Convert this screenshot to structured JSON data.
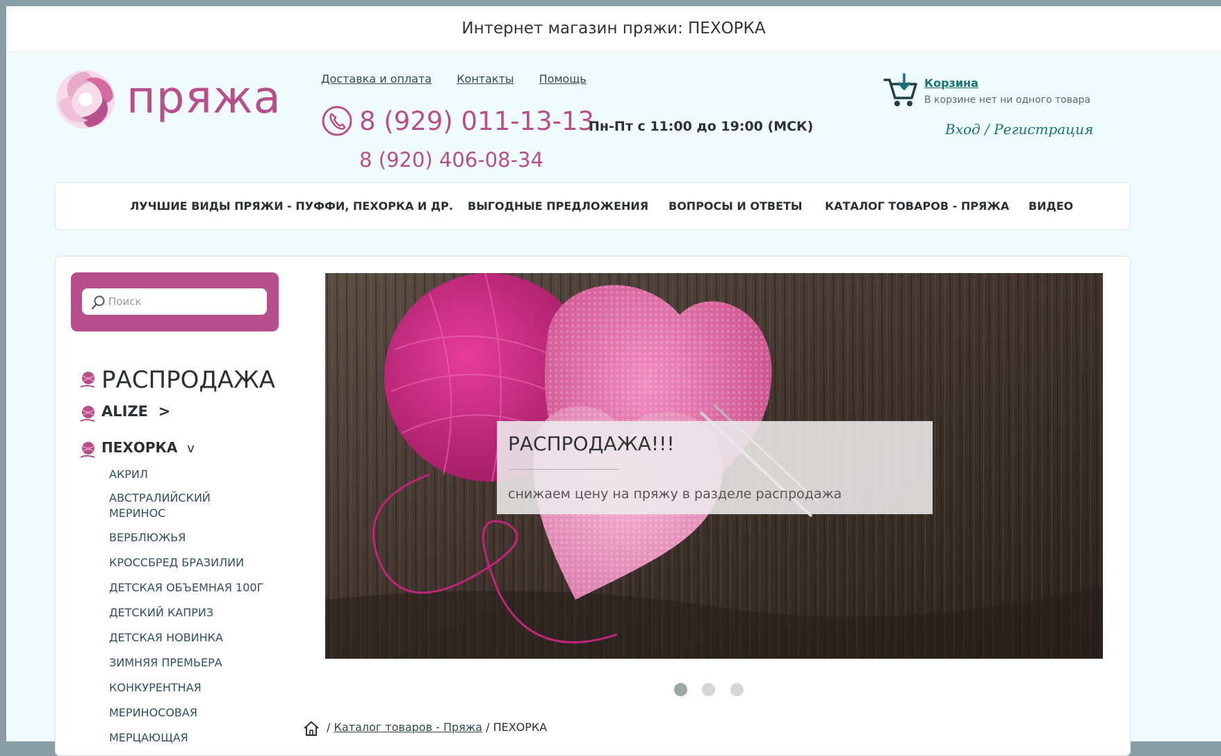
{
  "window": {
    "title": "Интернет магазин пряжи: ПЕХОРКА"
  },
  "header": {
    "logo_text": "пряжа",
    "links": [
      "Доставка и оплата",
      "Контакты",
      "Помощь"
    ],
    "phone_primary": "8 (929) 011-13-13",
    "phone_secondary": "8 (920) 406-08-34",
    "hours": "Пн-Пт с 11:00 до 19:00 (МСК)",
    "cart_title": "Корзина",
    "cart_status": "В корзине нет ни одного товара",
    "auth_links": "Вход / Регистрация"
  },
  "nav": {
    "items": [
      "ЛУЧШИЕ ВИДЫ ПРЯЖИ - ПУФФИ, ПЕХОРКА И ДР.",
      "ВЫГОДНЫЕ ПРЕДЛОЖЕНИЯ",
      "ВОПРОСЫ И ОТВЕТЫ",
      "КАТАЛОГ ТОВАРОВ - ПРЯЖА",
      "ВИДЕО"
    ]
  },
  "search": {
    "placeholder": "Поиск",
    "value": ""
  },
  "sidebar": {
    "sale": "РАСПРОДАЖА",
    "alize": {
      "label": "ALIZE",
      "arrow": ">"
    },
    "pekhorka": {
      "label": "ПЕХОРКА",
      "arrow": "v"
    },
    "subitems": [
      "АКРИЛ",
      "АВСТРАЛИЙСКИЙ МЕРИНОС",
      "ВЕРБЛЮЖЬЯ",
      "КРОССБРЕД БРАЗИЛИИ",
      "ДЕТСКАЯ ОБЪЕМНАЯ 100Г",
      "ДЕТСКИЙ КАПРИЗ",
      "ДЕТСКАЯ НОВИНКА",
      "ЗИМНЯЯ ПРЕМЬЕРА",
      "КОНКУРЕНТНАЯ",
      "МЕРИНОСОВАЯ",
      "МЕРЦАЮЩАЯ"
    ]
  },
  "banner": {
    "heading": "РАСПРОДАЖА!!!",
    "subtext": "снижаем цену на пряжу в разделе распродажа",
    "slide_count": 3,
    "active_slide": 1
  },
  "breadcrumb": {
    "separator": "/",
    "link": "Каталог товаров - Пряжа",
    "current": "ПЕХОРКА"
  },
  "colors": {
    "brand": "#b84f8d",
    "link": "#16737a",
    "page_bg": "#effbfd"
  },
  "icons": [
    "logo-swirl-icon",
    "phone-icon",
    "cart-icon",
    "search-icon",
    "yarn-ball-icon",
    "home-icon"
  ]
}
